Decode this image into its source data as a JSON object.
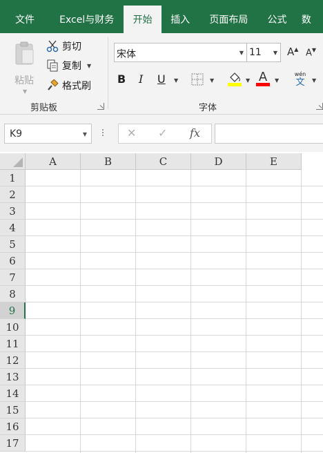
{
  "tabs": [
    {
      "label": "文件",
      "active": false
    },
    {
      "label": "Excel与财务",
      "active": false
    },
    {
      "label": "开始",
      "active": true
    },
    {
      "label": "插入",
      "active": false
    },
    {
      "label": "页面布局",
      "active": false
    },
    {
      "label": "公式",
      "active": false
    },
    {
      "label": "数",
      "active": false
    }
  ],
  "ribbon": {
    "clipboard": {
      "paste_label": "粘贴",
      "cut_label": "剪切",
      "copy_label": "复制",
      "format_painter_label": "格式刷",
      "group_label": "剪贴板"
    },
    "font": {
      "font_name": "宋体",
      "font_size": "11",
      "grow_label": "A",
      "shrink_label": "A",
      "bold_label": "B",
      "italic_label": "I",
      "underline_label": "U",
      "font_color_label": "A",
      "phonetic_top": "wén",
      "phonetic_bottom": "文",
      "group_label": "字体",
      "highlight_color": "#ffff00",
      "font_color": "#ff0000"
    }
  },
  "formula_bar": {
    "name_box": "K9",
    "cancel_symbol": "✕",
    "enter_symbol": "✓",
    "fx_label": "fx",
    "formula": ""
  },
  "grid": {
    "columns": [
      "A",
      "B",
      "C",
      "D",
      "E"
    ],
    "rows": [
      "1",
      "2",
      "3",
      "4",
      "5",
      "6",
      "7",
      "8",
      "9",
      "10",
      "11",
      "12",
      "13",
      "14",
      "15",
      "16",
      "17"
    ],
    "selected_row": "9"
  },
  "colors": {
    "brand": "#217346",
    "ribbon_bg": "#f3f3f3",
    "header_bg": "#e6e6e6"
  }
}
